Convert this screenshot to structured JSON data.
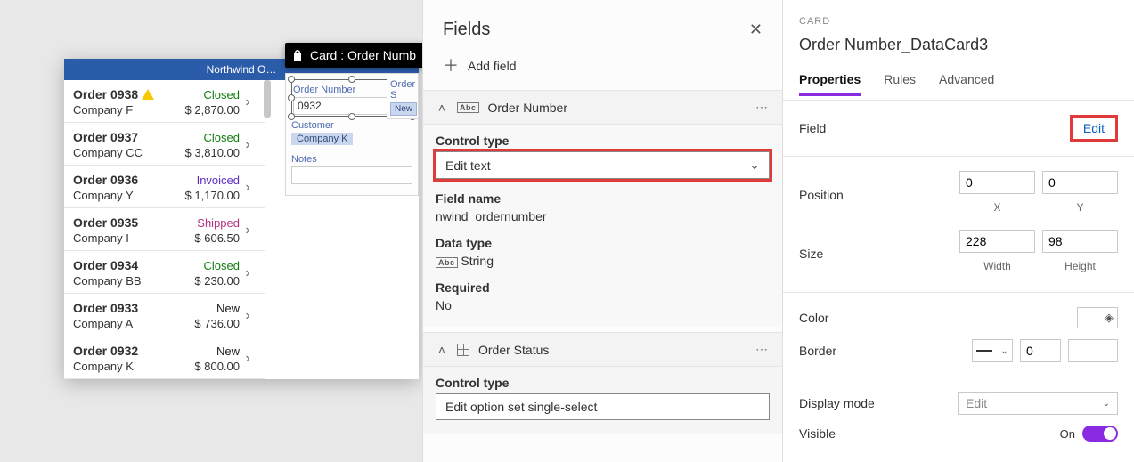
{
  "canvas": {
    "header": "Northwind O…",
    "orders": [
      {
        "title": "Order 0938",
        "company": "Company F",
        "status": "Closed",
        "status_cls": "st-closed",
        "price": "$ 2,870.00",
        "warn": true
      },
      {
        "title": "Order 0937",
        "company": "Company CC",
        "status": "Closed",
        "status_cls": "st-closed",
        "price": "$ 3,810.00"
      },
      {
        "title": "Order 0936",
        "company": "Company Y",
        "status": "Invoiced",
        "status_cls": "st-invoiced",
        "price": "$ 1,170.00"
      },
      {
        "title": "Order 0935",
        "company": "Company I",
        "status": "Shipped",
        "status_cls": "st-shipped",
        "price": "$ 606.50"
      },
      {
        "title": "Order 0934",
        "company": "Company BB",
        "status": "Closed",
        "status_cls": "st-closed",
        "price": "$ 230.00"
      },
      {
        "title": "Order 0933",
        "company": "Company A",
        "status": "New",
        "status_cls": "st-new",
        "price": "$ 736.00"
      },
      {
        "title": "Order 0932",
        "company": "Company K",
        "status": "New",
        "status_cls": "st-new",
        "price": "$ 800.00"
      }
    ]
  },
  "tooltip": {
    "text": "Card : Order Numb"
  },
  "form": {
    "labels": {
      "order_number": "Order Number",
      "customer": "Customer",
      "notes": "Notes",
      "order_s": "Order S"
    },
    "values": {
      "order_number": "0932",
      "customer": "Company K",
      "notes": ""
    },
    "badge_new": "New"
  },
  "fields": {
    "title": "Fields",
    "add": "Add field",
    "group1": {
      "title": "Order Number",
      "ctl_label": "Control type",
      "ctl_value": "Edit text",
      "fieldname_label": "Field name",
      "fieldname_value": "nwind_ordernumber",
      "datatype_label": "Data type",
      "datatype_value": "String",
      "required_label": "Required",
      "required_value": "No"
    },
    "group2": {
      "title": "Order Status",
      "ctl_label": "Control type",
      "ctl_value": "Edit option set single-select"
    }
  },
  "props": {
    "crumb": "CARD",
    "name": "Order Number_DataCard3",
    "tabs": {
      "properties": "Properties",
      "rules": "Rules",
      "advanced": "Advanced"
    },
    "field_label": "Field",
    "edit": "Edit",
    "position_label": "Position",
    "pos_x": "0",
    "pos_y": "0",
    "pos_xl": "X",
    "pos_yl": "Y",
    "size_label": "Size",
    "size_w": "228",
    "site_h_label_w": "Width",
    "size_h": "98",
    "site_h_label_h": "Height",
    "color_label": "Color",
    "border_label": "Border",
    "border_num": "0",
    "display_mode_label": "Display mode",
    "display_mode_value": "Edit",
    "visible_label": "Visible",
    "visible_value": "On"
  }
}
